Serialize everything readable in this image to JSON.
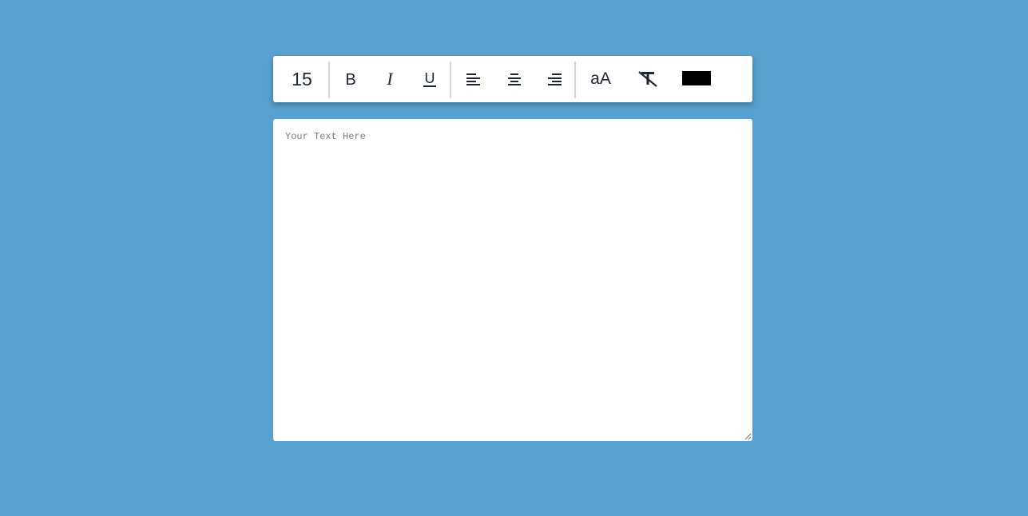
{
  "toolbar": {
    "font_size": "15",
    "bold_label": "B",
    "italic_label": "I",
    "underline_label": "U",
    "case_label": "aA",
    "align_left_icon": "align-left-icon",
    "align_center_icon": "align-center-icon",
    "align_right_icon": "align-right-icon",
    "clear_format_icon": "clear-format-icon",
    "text_color": "#000000"
  },
  "editor": {
    "placeholder": "Your Text Here",
    "value": ""
  },
  "colors": {
    "background": "#58a0cd",
    "panel": "#ffffff",
    "icon": "#1d2433"
  }
}
